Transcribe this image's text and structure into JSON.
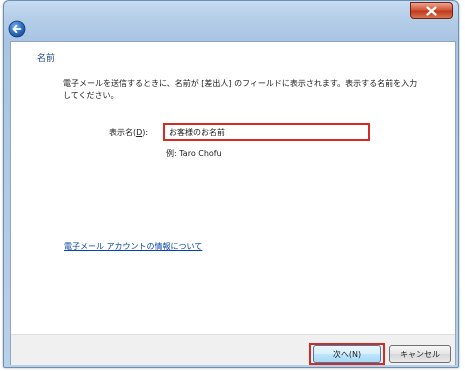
{
  "window": {
    "close_icon": "close-x-icon",
    "back_icon": "back-arrow-icon"
  },
  "page": {
    "title": "名前",
    "description": "電子メールを送信するときに、名前が [差出人] のフィールドに表示されます。表示する名前を入力してください。"
  },
  "form": {
    "label_prefix": "表示名(",
    "label_accel": "D",
    "label_suffix": "):",
    "value": "お客様のお名前",
    "example": "例: Taro Chofu"
  },
  "link": {
    "text": "電子メール アカウントの情報について"
  },
  "buttons": {
    "next": "次へ(N)",
    "cancel": "キャンセル"
  },
  "colors": {
    "highlight": "#d62b22",
    "title": "#1e4a88",
    "link": "#0645ad"
  }
}
